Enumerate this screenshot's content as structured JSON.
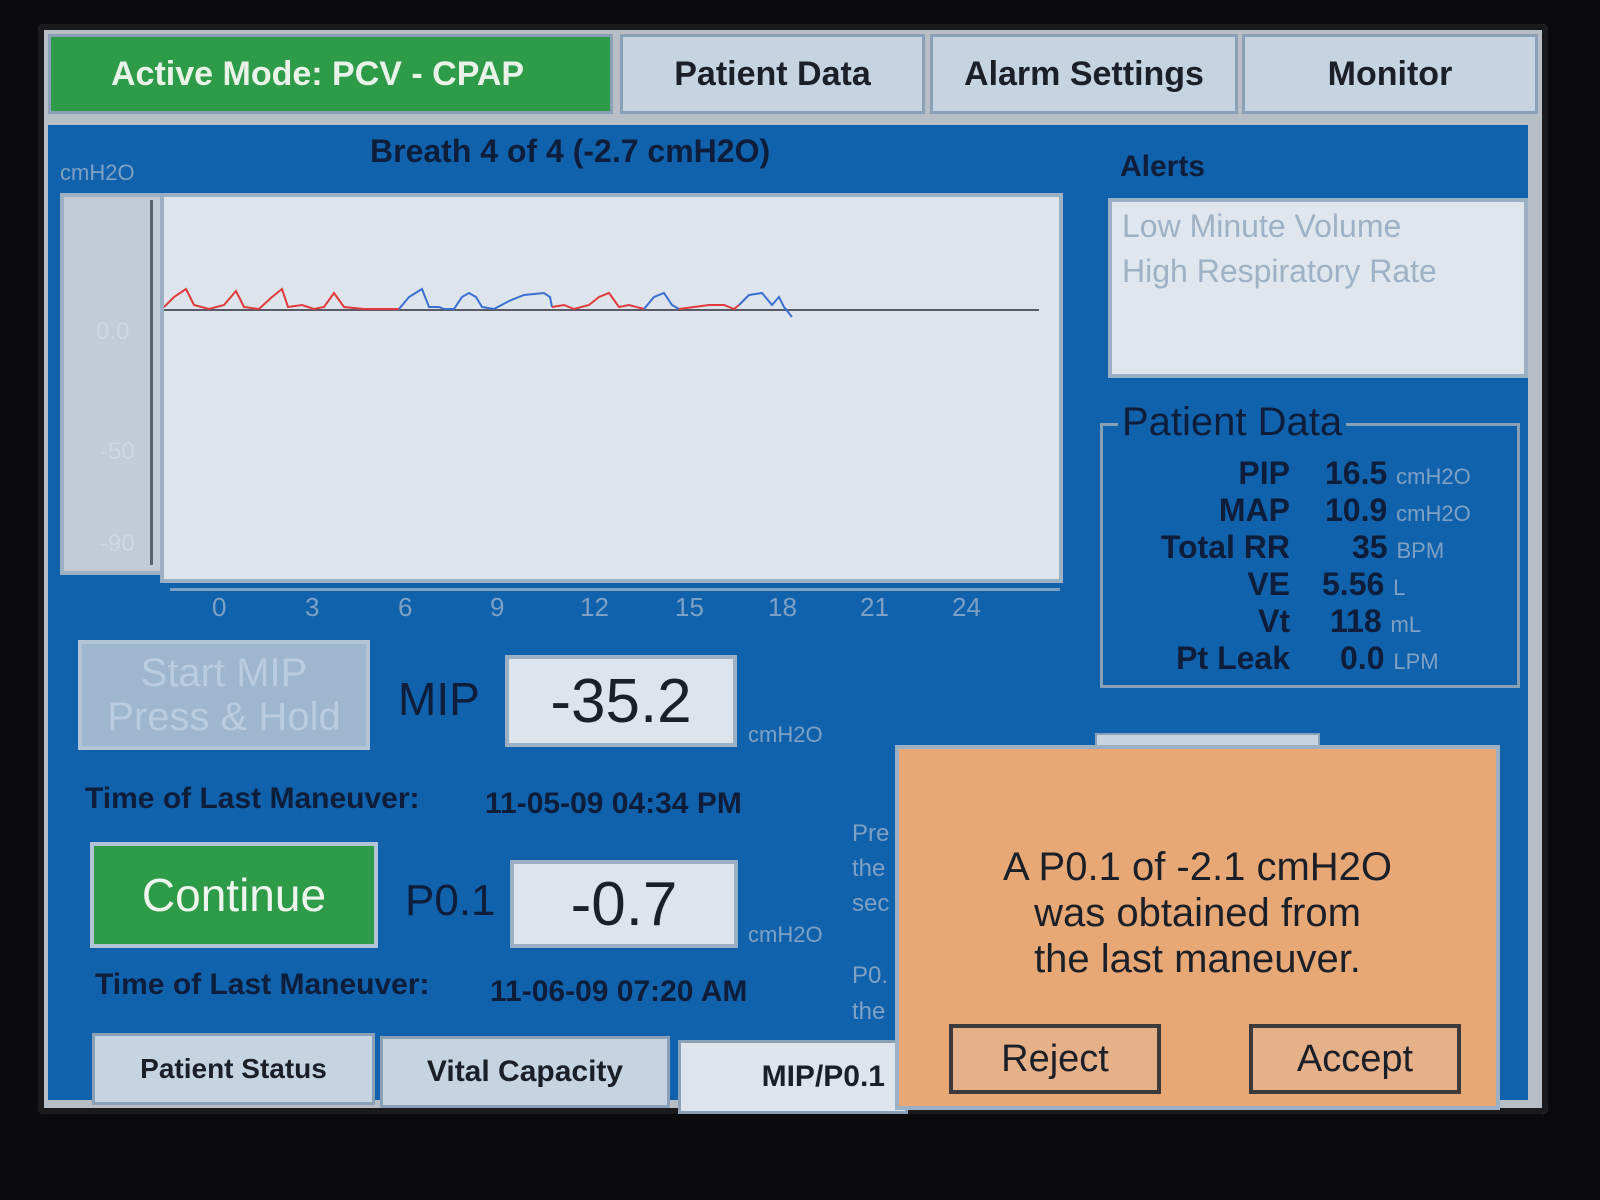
{
  "tabs": {
    "active_mode": "Active Mode:  PCV - CPAP",
    "patient_data": "Patient Data",
    "alarm_settings": "Alarm Settings",
    "monitor": "Monitor"
  },
  "waveform": {
    "title": "Breath 4 of 4 (-2.7 cmH2O)",
    "y_unit": "cmH2O",
    "y_ticks": [
      "0.0",
      "-50",
      "-90"
    ],
    "x_ticks": [
      "0",
      "3",
      "6",
      "9",
      "12",
      "15",
      "18",
      "21",
      "24"
    ],
    "colors": {
      "trace_red": "#e03a3a",
      "trace_blue": "#3a6fd0",
      "baseline": "#5a5a66"
    }
  },
  "alerts": {
    "title": "Alerts",
    "items": [
      "Low Minute Volume",
      "High Respiratory Rate"
    ]
  },
  "patient_data_panel": {
    "title": "Patient Data",
    "rows": [
      {
        "label": "PIP",
        "value": "16.5",
        "unit": "cmH2O"
      },
      {
        "label": "MAP",
        "value": "10.9",
        "unit": "cmH2O"
      },
      {
        "label": "Total RR",
        "value": "35",
        "unit": "BPM"
      },
      {
        "label": "VE",
        "value": "5.56",
        "unit": "L"
      },
      {
        "label": "Vt",
        "value": "118",
        "unit": "mL"
      },
      {
        "label": "Pt Leak",
        "value": "0.0",
        "unit": "LPM"
      }
    ]
  },
  "mip": {
    "button_line1": "Start MIP",
    "button_line2": "Press & Hold",
    "label": "MIP",
    "value": "-35.2",
    "unit": "cmH2O",
    "last_label": "Time of Last Maneuver:",
    "last_time": "11-05-09  04:34 PM"
  },
  "p01": {
    "button": "Continue",
    "label": "P0.1",
    "value": "-0.7",
    "unit": "cmH2O",
    "last_label": "Time of Last Maneuver:",
    "last_time": "11-06-09  07:20 AM"
  },
  "side_text": {
    "l1": "Pre",
    "l2": "the",
    "l3": "sec",
    "l4": "P0.",
    "l5": "the"
  },
  "popup": {
    "message_line1": "A P0.1 of -2.1 cmH2O",
    "message_line2": "was obtained from",
    "message_line3": "the last maneuver.",
    "reject": "Reject",
    "accept": "Accept"
  },
  "bottom_tabs": {
    "patient_status": "Patient Status",
    "vital_capacity": "Vital Capacity",
    "mip_p01": "MIP/P0.1"
  }
}
